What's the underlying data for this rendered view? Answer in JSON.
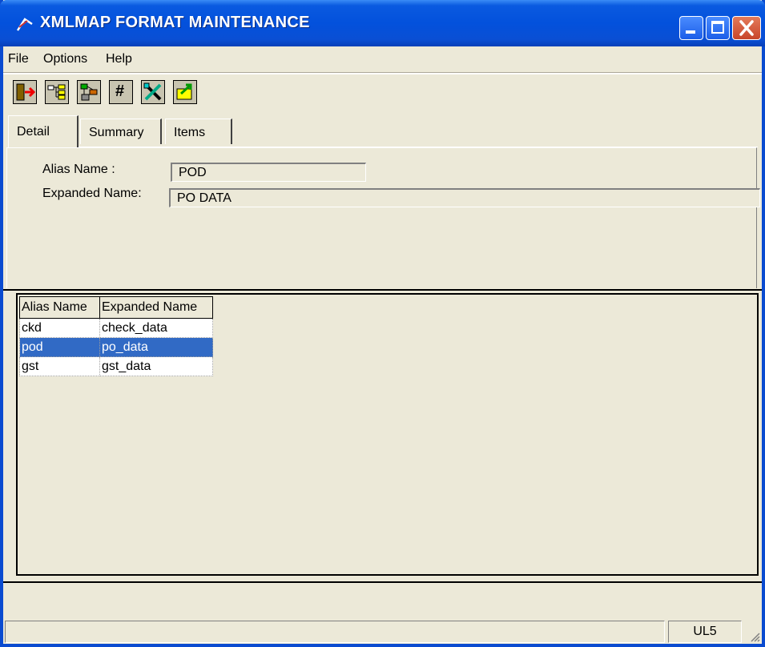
{
  "window": {
    "title": "XMLMAP FORMAT MAINTENANCE"
  },
  "menu": {
    "items": [
      "File",
      "Options",
      "Help"
    ]
  },
  "toolbar": {
    "buttons": [
      {
        "icon": "exit-icon"
      },
      {
        "icon": "tree-icon"
      },
      {
        "icon": "structure-icon"
      },
      {
        "icon": "hash-icon"
      },
      {
        "icon": "tools-icon"
      },
      {
        "icon": "export-icon"
      }
    ]
  },
  "tabs": {
    "detail": "Detail",
    "summary": "Summary",
    "items": "Items"
  },
  "detail": {
    "alias_label": "Alias Name :",
    "alias_value": "POD",
    "expanded_label": "Expanded Name:",
    "expanded_value": "PO DATA"
  },
  "list": {
    "columns": [
      "Alias Name",
      "Expanded Name"
    ],
    "rows": [
      {
        "alias": "ckd",
        "expanded": "check_data"
      },
      {
        "alias": "pod",
        "expanded": "po_data"
      },
      {
        "alias": "gst",
        "expanded": "gst_data"
      }
    ],
    "selected_index": 1
  },
  "status": {
    "panel_right": "UL5"
  },
  "colors": {
    "titlebar": "#0351dc",
    "selection": "#316ac5",
    "face": "#ece9d8"
  }
}
